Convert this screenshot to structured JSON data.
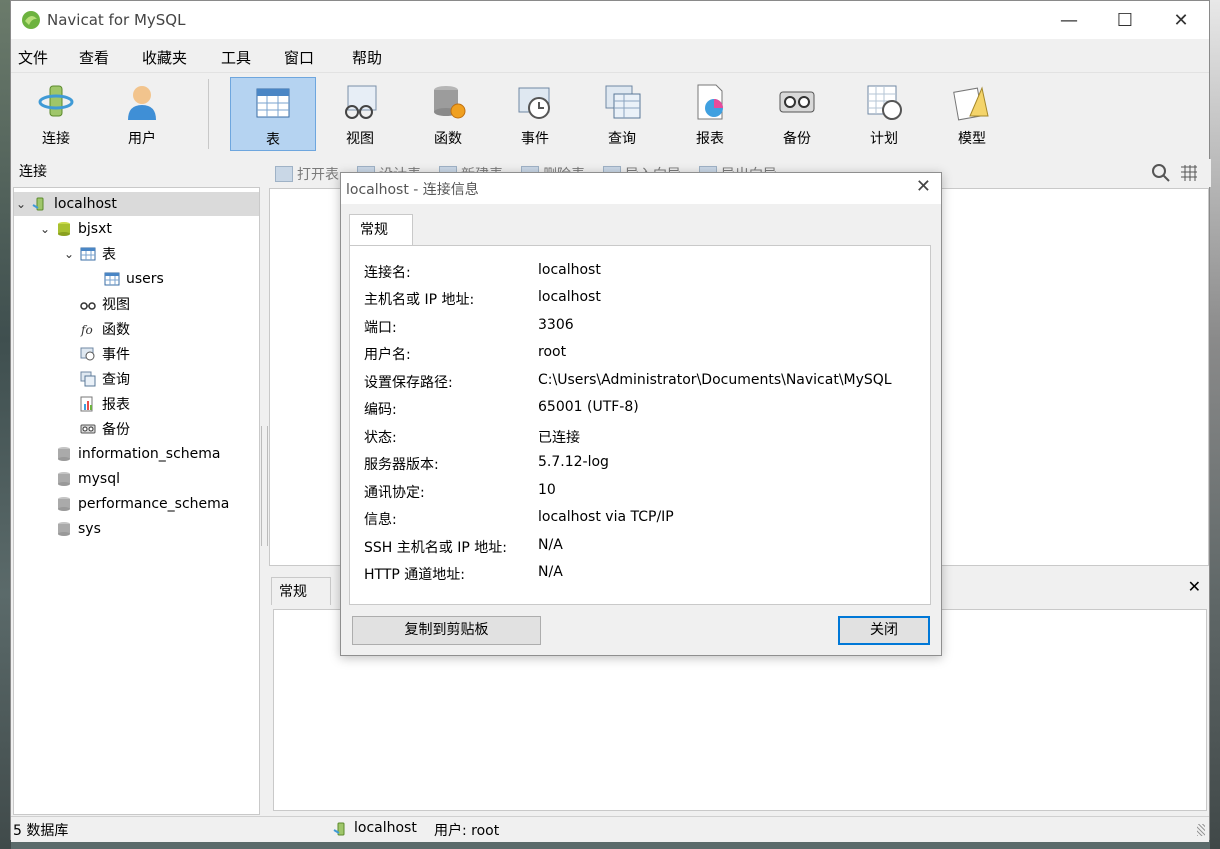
{
  "window": {
    "title": "Navicat for MySQL",
    "minimize": "—",
    "maximize": "☐",
    "close": "✕"
  },
  "menu": [
    "文件",
    "查看",
    "收藏夹",
    "工具",
    "窗口",
    "帮助"
  ],
  "toolbar": {
    "connect": "连接",
    "user": "用户",
    "table": "表",
    "view": "视图",
    "function": "函数",
    "event": "事件",
    "query": "查询",
    "report": "报表",
    "backup": "备份",
    "schedule": "计划",
    "model": "模型"
  },
  "left_header": "连接",
  "tree": {
    "host": "localhost",
    "db": "bjsxt",
    "tables": "表",
    "table_users": "users",
    "views": "视图",
    "functions": "函数",
    "events": "事件",
    "queries": "查询",
    "reports": "报表",
    "backups": "备份",
    "other_dbs": [
      "information_schema",
      "mysql",
      "performance_schema",
      "sys"
    ]
  },
  "object_toolbar": [
    "打开表",
    "设计表",
    "新建表",
    "删除表",
    "导入向导",
    "导出向导"
  ],
  "bottom": {
    "tab": "常规",
    "close": "✕"
  },
  "status": {
    "db_count": "5 数据库",
    "connection": "localhost",
    "user": "用户: root"
  },
  "dialog": {
    "title": "localhost - 连接信息",
    "close": "✕",
    "tab": "常规",
    "rows": [
      {
        "label": "连接名:",
        "value": "localhost"
      },
      {
        "label": "主机名或 IP 地址:",
        "value": "localhost"
      },
      {
        "label": "端口:",
        "value": "3306"
      },
      {
        "label": "用户名:",
        "value": "root"
      },
      {
        "label": "设置保存路径:",
        "value": "C:\\Users\\Administrator\\Documents\\Navicat\\MySQL"
      },
      {
        "label": "编码:",
        "value": "65001 (UTF-8)"
      },
      {
        "label": "状态:",
        "value": "已连接"
      },
      {
        "label": "服务器版本:",
        "value": "5.7.12-log"
      },
      {
        "label": "通讯协定:",
        "value": "10"
      },
      {
        "label": "信息:",
        "value": "localhost via TCP/IP"
      },
      {
        "label": "SSH 主机名或 IP 地址:",
        "value": "N/A"
      },
      {
        "label": "HTTP 通道地址:",
        "value": "N/A"
      }
    ],
    "copy_button": "复制到剪贴板",
    "close_button": "关闭"
  }
}
